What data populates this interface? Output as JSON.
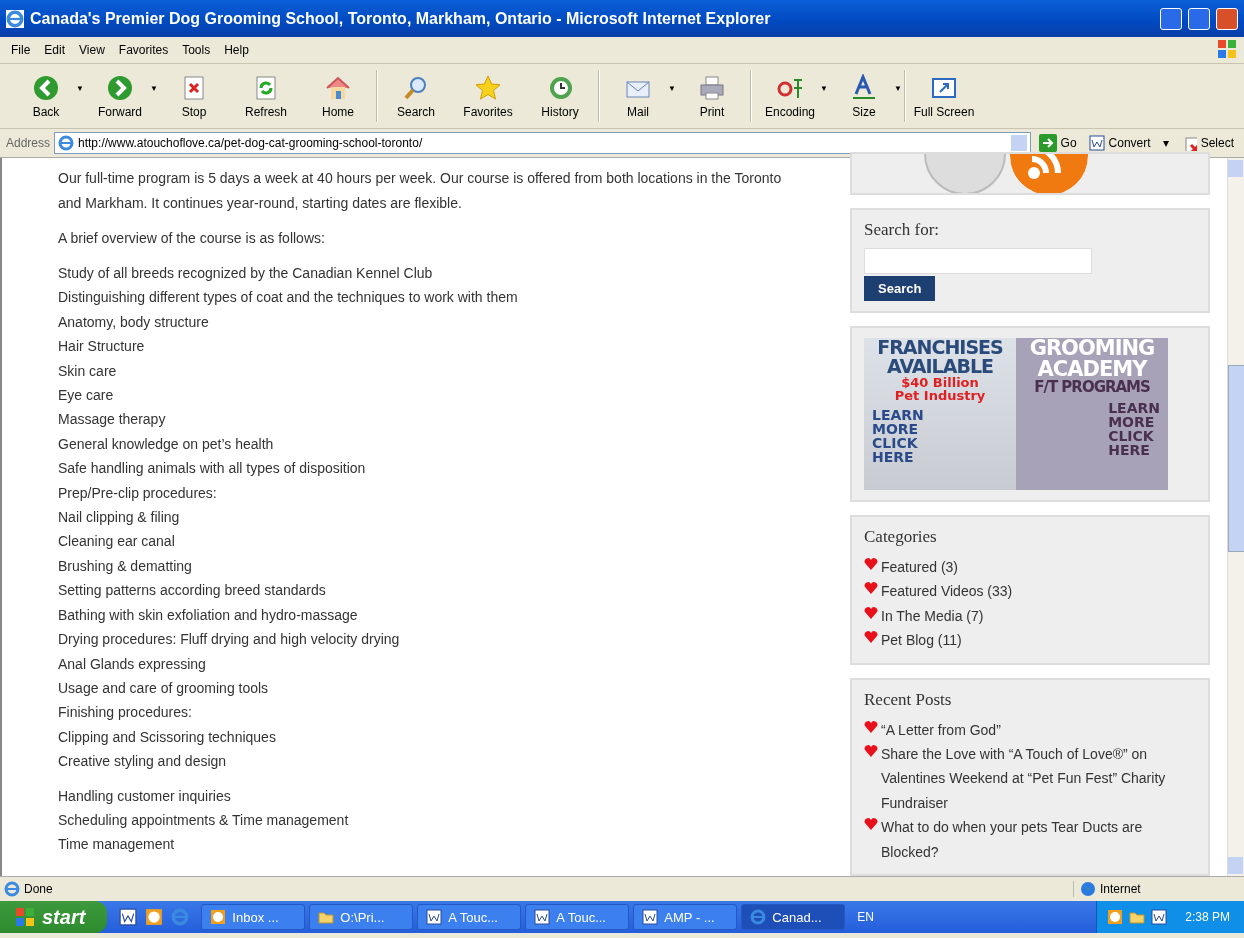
{
  "window": {
    "title": "Canada's Premier Dog Grooming School, Toronto, Markham, Ontario - Microsoft Internet Explorer"
  },
  "menu": [
    "File",
    "Edit",
    "View",
    "Favorites",
    "Tools",
    "Help"
  ],
  "toolbar": [
    {
      "label": "Back",
      "kind": "back",
      "menu_arrow": "▼"
    },
    {
      "label": "Forward",
      "kind": "forward",
      "menu_arrow": "▼"
    },
    {
      "label": "Stop",
      "kind": "stop"
    },
    {
      "label": "Refresh",
      "kind": "refresh"
    },
    {
      "label": "Home",
      "kind": "home",
      "group_end": true
    },
    {
      "label": "Search",
      "kind": "search"
    },
    {
      "label": "Favorites",
      "kind": "star"
    },
    {
      "label": "History",
      "kind": "history",
      "group_end": true
    },
    {
      "label": "Mail",
      "kind": "mail",
      "menu_arrow": "▼"
    },
    {
      "label": "Print",
      "kind": "print",
      "group_end": true
    },
    {
      "label": "Encoding",
      "kind": "encoding",
      "menu_arrow": "▼"
    },
    {
      "label": "Size",
      "kind": "size",
      "menu_arrow": "▼",
      "group_end": true
    },
    {
      "label": "Full Screen",
      "kind": "fullscreen"
    }
  ],
  "address": {
    "label": "Address",
    "url": "http://www.atouchoflove.ca/pet-dog-cat-grooming-school-toronto/",
    "go": "Go",
    "convert": "Convert",
    "convert_arrow": "▾",
    "select": "Select"
  },
  "article": {
    "intro": "Our full-time program is 5 days a week at 40 hours per week. Our course is offered from both locations in the Toronto and Markham. It continues year-round, starting dates are flexible.",
    "overview": "A brief overview of the course is as follows:",
    "lists": [
      [
        "Study of all breeds recognized by the Canadian Kennel Club",
        "Distinguishing different types of coat and the techniques to work with them",
        "Anatomy, body structure",
        "Hair Structure",
        "Skin care",
        "Eye care",
        "Massage therapy",
        "General knowledge on pet’s health",
        "Safe handling animals with all types of disposition",
        "Prep/Pre-clip procedures:",
        "Nail clipping & filing",
        "Cleaning ear canal",
        "Brushing & dematting",
        "Setting patterns according breed standards",
        "Bathing with skin exfoliation and hydro-massage",
        "Drying procedures: Fluff drying and high velocity drying",
        "Anal Glands expressing",
        "Usage and care of grooming tools",
        "Finishing procedures:",
        "Clipping and Scissoring techniques",
        "Creative styling and design"
      ],
      [
        "Handling customer inquiries",
        "Scheduling appointments & Time management",
        "Time management"
      ]
    ]
  },
  "sidebar": {
    "search": {
      "title": "Search for:",
      "button": "Search"
    },
    "ad": {
      "left": [
        "FRANCHISES",
        "AVAILABLE"
      ],
      "left_red": [
        "$40 Billion",
        "Pet Industry"
      ],
      "left_cta": [
        "LEARN",
        "MORE",
        "CLICK",
        "HERE"
      ],
      "right": [
        "GROOMING",
        "ACADEMY"
      ],
      "right_sub": "F/T PROGRAMS",
      "right_cta": [
        "LEARN",
        "MORE",
        "CLICK",
        "HERE"
      ]
    },
    "categories": {
      "title": "Categories",
      "items": [
        "Featured (3)",
        "Featured Videos (33)",
        "In The Media (7)",
        "Pet Blog (11)"
      ]
    },
    "recent": {
      "title": "Recent Posts",
      "items": [
        "“A Letter from God”",
        "Share the Love with “A Touch of Love®” on Valentines Weekend at “Pet Fun Fest” Charity Fundraiser",
        "What to do when your pets Tear Ducts are Blocked?"
      ]
    }
  },
  "status_bar": {
    "text": "Done",
    "zone": "Internet"
  },
  "taskbar": {
    "start": "start",
    "tasks": [
      {
        "label": "Inbox ...",
        "kind": "clock",
        "selected": false
      },
      {
        "label": "O:\\Pri...",
        "kind": "folder",
        "selected": false
      },
      {
        "label": "A Touc...",
        "kind": "word",
        "selected": false
      },
      {
        "label": "A Touc...",
        "kind": "word",
        "selected": false
      },
      {
        "label": "AMP - ...",
        "kind": "word",
        "selected": false
      },
      {
        "label": "Canad...",
        "kind": "ie",
        "selected": true
      }
    ],
    "lang": "EN",
    "time": "2:38 PM"
  }
}
